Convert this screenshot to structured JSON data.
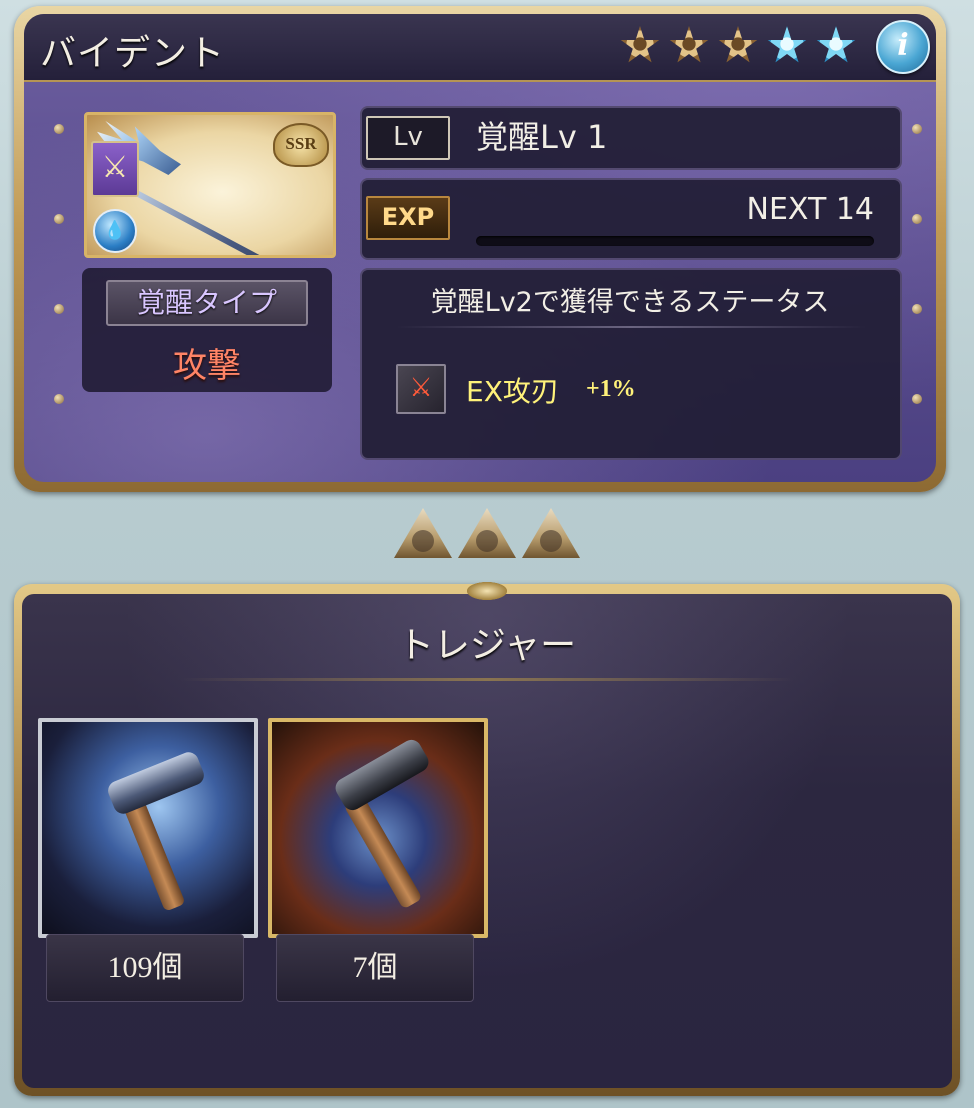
{
  "weapon": {
    "name": "バイデント",
    "rarity_badge": "SSR",
    "stars": [
      {
        "type": "gold"
      },
      {
        "type": "gold"
      },
      {
        "type": "gold"
      },
      {
        "type": "blue"
      },
      {
        "type": "blue"
      }
    ],
    "info_icon": "i"
  },
  "awakening": {
    "type_label": "覚醒タイプ",
    "type_value": "攻撃",
    "lv_tag": "Lv",
    "lv_text": "覚醒Lv 1",
    "exp_tag": "EXP",
    "next_text": "NEXT 14",
    "exp_progress": 0.0
  },
  "status_gain": {
    "title": "覚醒Lv2で獲得できるステータス",
    "skill_name": "EX攻刃",
    "skill_value": "+1%"
  },
  "treasure": {
    "title": "トレジャー",
    "items": [
      {
        "count": "109個"
      },
      {
        "count": "7個"
      }
    ]
  },
  "colors": {
    "panel_purple": "#5a4d8e",
    "frame_gold": "#c19a55",
    "awake_type_red": "#ff8466",
    "skill_yellow": "#fff27a"
  },
  "icons": {
    "weapon_type": "spear-icon",
    "element": "water-element-icon",
    "skill": "ex-attack-up-icon"
  }
}
